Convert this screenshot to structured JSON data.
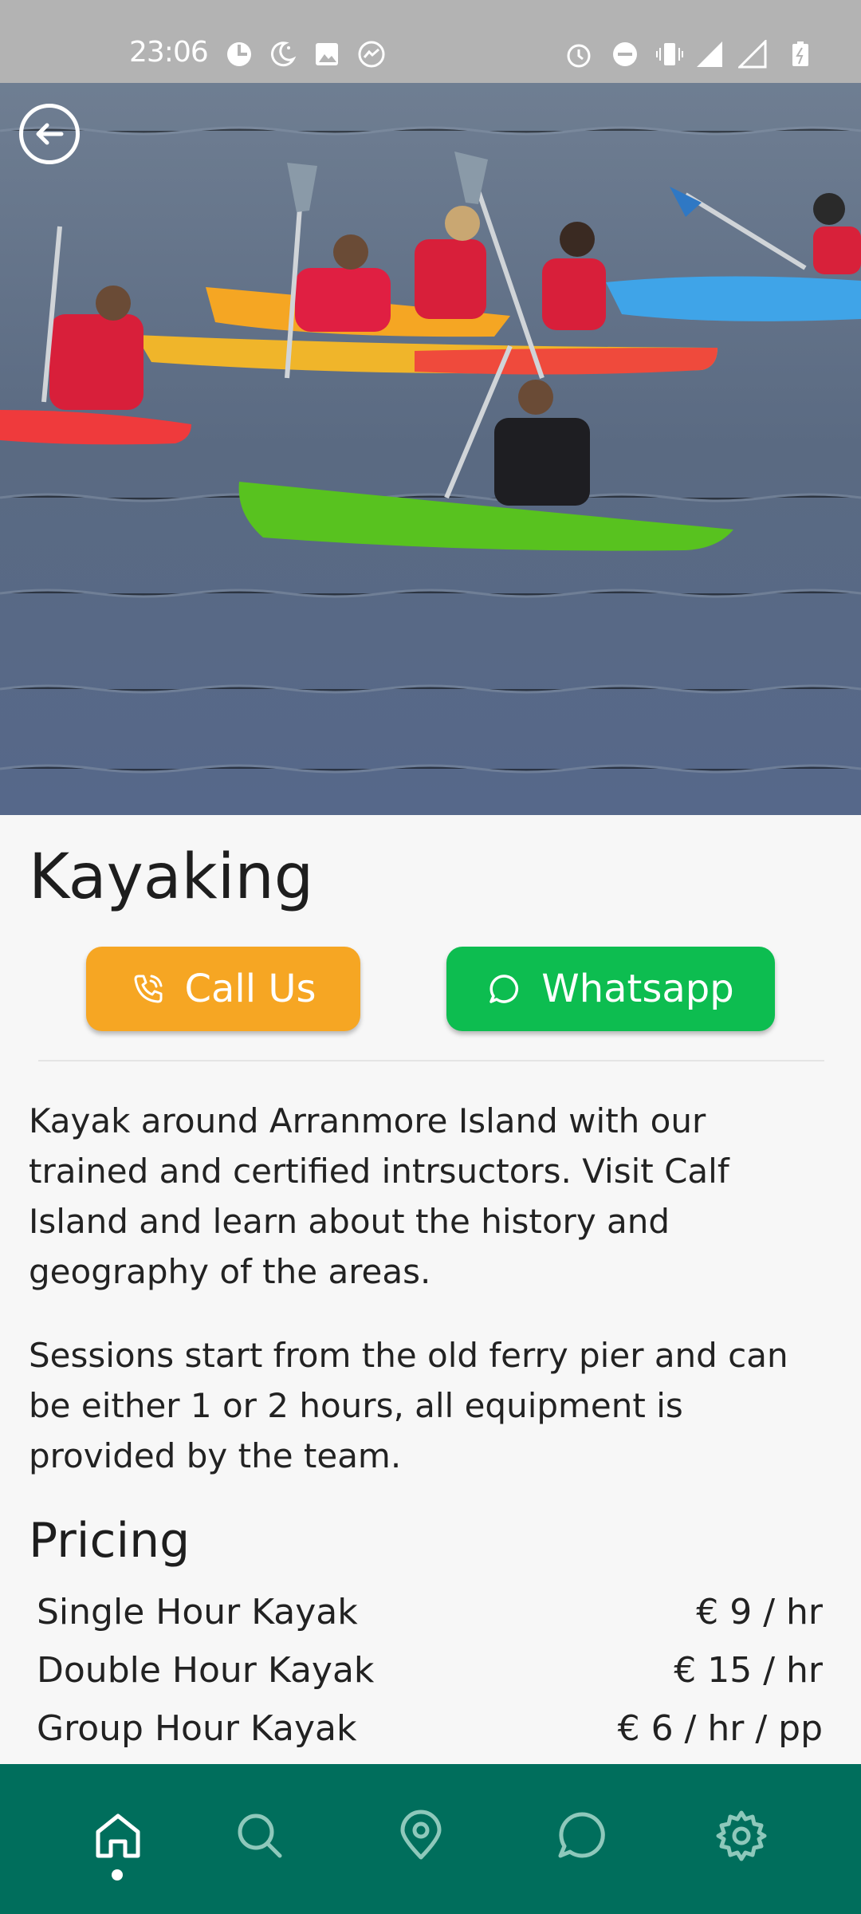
{
  "status_bar": {
    "time": "23:06",
    "left_icons": [
      "data-saver-icon",
      "night-mode-icon",
      "gallery-icon",
      "messenger-icon"
    ],
    "right_icons": [
      "alarm-icon",
      "do-not-disturb-icon",
      "vibrate-icon",
      "signal-r-icon",
      "signal-4g-icon",
      "battery-icon"
    ]
  },
  "hero": {
    "image_alt": "Group of kayakers paddling on the sea",
    "back_icon": "back-arrow-icon"
  },
  "page": {
    "title": "Kayaking",
    "call_button": {
      "label": "Call Us",
      "icon": "phone-icon",
      "color": "#f6a623"
    },
    "whatsapp_button": {
      "label": "Whatsapp",
      "icon": "chat-bubble-icon",
      "color": "#0dbd50"
    },
    "description": [
      "Kayak around Arranmore Island with our trained and certified intrsuctors. Visit Calf Island and learn about the history and geography of the areas.",
      "Sessions start from the old ferry pier and can be either 1 or 2 hours, all equipment is provided by the team."
    ],
    "pricing_heading": "Pricing",
    "pricing": [
      {
        "name": "Single Hour Kayak",
        "price": "€ 9 / hr"
      },
      {
        "name": "Double Hour Kayak",
        "price": "€ 15 / hr"
      },
      {
        "name": "Group Hour Kayak",
        "price": "€ 6 / hr / pp"
      }
    ]
  },
  "bottom_nav": {
    "background": "#006e5c",
    "active": "home",
    "items": [
      {
        "id": "home",
        "icon": "home-icon"
      },
      {
        "id": "search",
        "icon": "search-icon"
      },
      {
        "id": "map",
        "icon": "map-pin-icon"
      },
      {
        "id": "chat",
        "icon": "chat-icon"
      },
      {
        "id": "settings",
        "icon": "gear-icon"
      }
    ]
  }
}
